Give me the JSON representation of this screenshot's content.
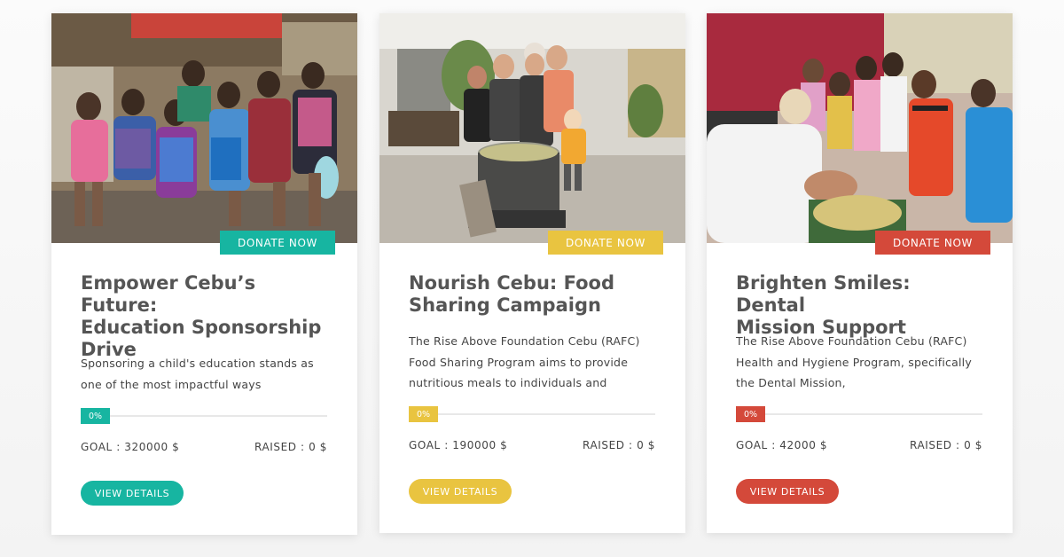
{
  "cards": [
    {
      "image_alt": "children-with-backpacks-photo",
      "donate_label": "DONATE NOW",
      "title_lines": [
        "Empower Cebu’s Future:",
        "Education Sponsorship",
        "Drive"
      ],
      "desc_lines": [
        "Sponsoring a child's education stands as",
        "one of the most impactful ways"
      ],
      "progress_percent": 0,
      "progress_label": "0%",
      "goal": "GOAL : 320000 $",
      "raised": "RAISED : 0 $",
      "view_label": "VIEW DETAILS",
      "accent": "#17b5a1"
    },
    {
      "image_alt": "food-sharing-cooking-pot-photo",
      "donate_label": "DONATE NOW",
      "title_lines": [
        "Nourish Cebu: Food",
        "Sharing Campaign"
      ],
      "desc_lines": [
        "The Rise Above Foundation Cebu (RAFC)",
        "Food Sharing Program aims to provide",
        "nutritious meals to individuals and"
      ],
      "progress_percent": 0,
      "progress_label": "0%",
      "goal": "GOAL : 190000 $",
      "raised": "RAISED : 0 $",
      "view_label": "VIEW DETAILS",
      "accent": "#e9c440"
    },
    {
      "image_alt": "dental-mission-checkup-photo",
      "donate_label": "DONATE NOW",
      "title_lines": [
        "Brighten Smiles: Dental",
        "Mission Support"
      ],
      "desc_lines": [
        "The Rise Above Foundation Cebu (RAFC)",
        "Health and Hygiene Program, specifically",
        "the Dental Mission,"
      ],
      "progress_percent": 0,
      "progress_label": "0%",
      "goal": "GOAL : 42000 $",
      "raised": "RAISED : 0 $",
      "view_label": "VIEW DETAILS",
      "accent": "#d4493a"
    }
  ]
}
